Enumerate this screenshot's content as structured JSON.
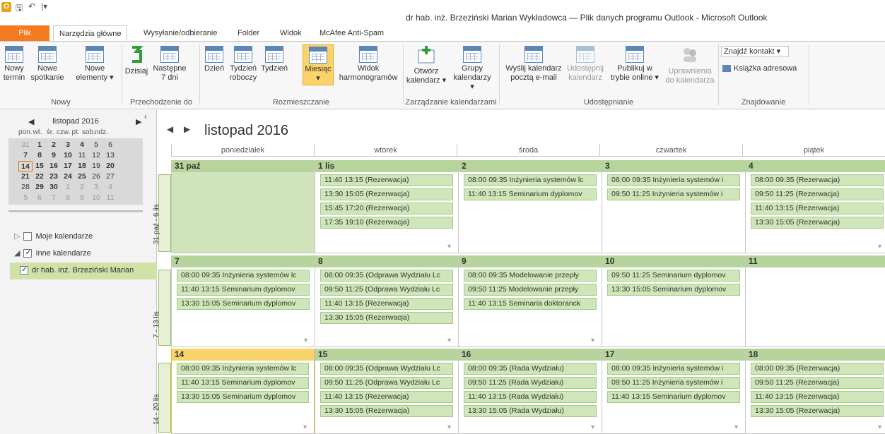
{
  "window": {
    "title": "dr hab. inż. Brzeziński Marian Wykładowca — Plik danych programu Outlook - Microsoft Outlook"
  },
  "tabs": [
    {
      "label": "Plik"
    },
    {
      "label": "Narzędzia główne"
    },
    {
      "label": "Wysyłanie/odbieranie"
    },
    {
      "label": "Folder"
    },
    {
      "label": "Widok"
    },
    {
      "label": "McAfee Anti-Spam"
    }
  ],
  "ribbon": {
    "groups": {
      "nowy": "Nowy",
      "przechodzenie": "Przechodzenie do",
      "rozmieszczanie": "Rozmieszczanie",
      "zarzadzanie": "Zarządzanie kalendarzami",
      "udostepnianie": "Udostępnianie",
      "znajdowanie": "Znajdowanie"
    },
    "buttons": {
      "nowy_termin": [
        "Nowy",
        "termin"
      ],
      "nowe_spotkanie": [
        "Nowe",
        "spotkanie"
      ],
      "nowe_elementy": [
        "Nowe",
        "elementy ▾"
      ],
      "dzisiaj": [
        "Dzisiaj",
        ""
      ],
      "nastepne": [
        "Następne",
        "7 dni"
      ],
      "dzien": [
        "Dzień",
        ""
      ],
      "tydzien_roboczy": [
        "Tydzień",
        "roboczy"
      ],
      "tydzien": [
        "Tydzień",
        ""
      ],
      "miesiac": [
        "Miesiąc",
        "▾"
      ],
      "widok_harm": [
        "Widok",
        "harmonogramów"
      ],
      "otworz": [
        "Otwórz",
        "kalendarz ▾"
      ],
      "grupy": [
        "Grupy",
        "kalendarzy ▾"
      ],
      "wyslij": [
        "Wyślij kalendarz",
        "pocztą e-mail"
      ],
      "udostepnij": [
        "Udostępnij",
        "kalendarz"
      ],
      "publikuj": [
        "Publikuj w",
        "trybie online ▾"
      ],
      "uprawnienia": [
        "Uprawnienia",
        "do kalendarza"
      ]
    },
    "find_contact": "Znajdź kontakt ▾",
    "address_book": "Książka adresowa"
  },
  "mini_calendar": {
    "month": "listopad 2016",
    "weekdays": [
      "pon.",
      "wt.",
      "śr.",
      "czw.",
      "pt.",
      "sob.",
      "ndz."
    ],
    "rows": [
      [
        "31",
        "1",
        "2",
        "3",
        "4",
        "5",
        "6"
      ],
      [
        "7",
        "8",
        "9",
        "10",
        "11",
        "12",
        "13"
      ],
      [
        "14",
        "15",
        "16",
        "17",
        "18",
        "19",
        "20"
      ],
      [
        "21",
        "22",
        "23",
        "24",
        "25",
        "26",
        "27"
      ],
      [
        "28",
        "29",
        "30",
        "1",
        "2",
        "3",
        "4"
      ],
      [
        "5",
        "6",
        "7",
        "8",
        "9",
        "10",
        "11"
      ]
    ],
    "bold_days": [
      "1",
      "2",
      "3",
      "4",
      "7",
      "8",
      "9",
      "10",
      "14",
      "15",
      "16",
      "17",
      "18",
      "20",
      "21",
      "22",
      "23",
      "24",
      "25",
      "29",
      "30"
    ],
    "today": "14"
  },
  "nav": {
    "my_calendars": "Moje kalendarze",
    "other_calendars": "Inne kalendarze",
    "selected_calendar": "dr hab. inż. Brzeziński Marian"
  },
  "calendar": {
    "month_title": "listopad 2016",
    "day_headers": [
      "poniedziałek",
      "wtorek",
      "środa",
      "czwartek",
      "piątek"
    ],
    "weeks": [
      {
        "label": "31 paź - 6 lis",
        "days": [
          {
            "num": "31 paź",
            "appts": []
          },
          {
            "num": "1 lis",
            "appts": [
              "11:40 13:15 (Rezerwacja)",
              "13:30 15:05 (Rezerwacja)",
              "15:45 17:20 (Rezerwacja)",
              "17:35 19:10 (Rezerwacja)"
            ]
          },
          {
            "num": "2",
            "appts": [
              "08:00 09:35 Inżynieria systemów lc",
              "11:40 13:15 Seminarium dyplomov"
            ]
          },
          {
            "num": "3",
            "appts": [
              "08:00 09:35 Inżynieria systemów i",
              "09:50 11:25 Inżynieria systemów i"
            ]
          },
          {
            "num": "4",
            "appts": [
              "08:00 09:35 (Rezerwacja)",
              "09:50 11:25 (Rezerwacja)",
              "11:40 13:15 (Rezerwacja)",
              "13:30 15:05 (Rezerwacja)"
            ]
          }
        ]
      },
      {
        "label": "7 - 13 lis",
        "days": [
          {
            "num": "7",
            "appts": [
              "08:00 09:35 Inżynieria systemów lc",
              "11:40 13:15 Seminarium dyplomov",
              "13:30 15:05 Seminarium dyplomov"
            ]
          },
          {
            "num": "8",
            "appts": [
              "08:00 09:35 (Odprawa Wydziału Lc",
              "09:50 11:25 (Odprawa Wydziału Lc",
              "11:40 13:15 (Rezerwacja)",
              "13:30 15:05 (Rezerwacja)"
            ]
          },
          {
            "num": "9",
            "appts": [
              "08:00 09:35 Modelowanie przepły",
              "09:50 11:25 Modelowanie przepły",
              "11:40 13:15 Seminaria doktoranck"
            ]
          },
          {
            "num": "10",
            "appts": [
              "09:50 11:25 Seminarium dyplomov",
              "13:30 15:05 Seminarium dyplomov"
            ]
          },
          {
            "num": "11",
            "appts": []
          }
        ]
      },
      {
        "label": "14 - 20 lis",
        "days": [
          {
            "num": "14",
            "appts": [
              "08:00 09:35 Inżynieria systemów lc",
              "11:40 13:15 Seminarium dyplomov",
              "13:30 15:05 Seminarium dyplomov"
            ]
          },
          {
            "num": "15",
            "appts": [
              "08:00 09:35 (Odprawa Wydziału Lc",
              "09:50 11:25 (Odprawa Wydziału Lc",
              "11:40 13:15 (Rezerwacja)",
              "13:30 15:05 (Rezerwacja)"
            ]
          },
          {
            "num": "16",
            "appts": [
              "08:00 09:35 (Rada Wydziału)",
              "09:50 11:25 (Rada Wydziału)",
              "11:40 13:15 (Rada Wydziału)",
              "13:30 15:05 (Rada Wydziału)"
            ]
          },
          {
            "num": "17",
            "appts": [
              "08:00 09:35 Inżynieria systemów i",
              "09:50 11:25 Inżynieria systemów i",
              "11:40 13:15 Seminarium dyplomov"
            ]
          },
          {
            "num": "18",
            "appts": [
              "08:00 09:35 (Rezerwacja)",
              "09:50 11:25 (Rezerwacja)",
              "11:40 13:15 (Rezerwacja)",
              "13:30 15:05 (Rezerwacja)"
            ]
          }
        ]
      }
    ]
  },
  "colors": {
    "file_tab": "#f47b20",
    "appt_bg": "#cfe6b8",
    "day_header": "#b6d49b",
    "today": "#f8d36a"
  }
}
